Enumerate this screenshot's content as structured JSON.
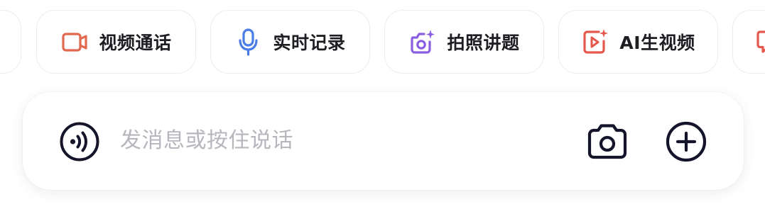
{
  "quick_actions": [
    {
      "label": "",
      "icon": "partial-chip-left",
      "color": "#ffffff"
    },
    {
      "label": "视频通话",
      "icon": "video-call-icon",
      "color": "#e2684f"
    },
    {
      "label": "实时记录",
      "icon": "microphone-icon",
      "color": "#4a7de6"
    },
    {
      "label": "拍照讲题",
      "icon": "camera-sparkle-icon",
      "color": "#8a5ee0"
    },
    {
      "label": "AI生视频",
      "icon": "ai-video-icon",
      "color": "#e5584d"
    },
    {
      "label": "",
      "icon": "partial-chip-right-icon",
      "color": "#e5584d"
    }
  ],
  "input": {
    "placeholder": "发消息或按住说话",
    "voice_icon": "voice-waves-icon",
    "camera_icon": "camera-icon",
    "plus_icon": "plus-circle-icon",
    "icon_color": "#14142b"
  }
}
